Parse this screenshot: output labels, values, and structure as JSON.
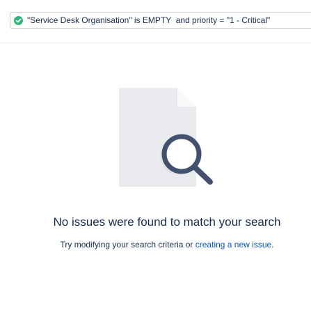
{
  "search": {
    "status_icon": "check-circle-icon",
    "query": "\"Service Desk Organisation\" is EMPTY  and priority = \"1 - Critical\""
  },
  "empty_state": {
    "illustration_icon": "document-search-icon",
    "title": "No issues were found to match your search",
    "subtitle_prefix": "Try modifying your search criteria or ",
    "create_link": "creating a new issue",
    "subtitle_suffix": "."
  },
  "colors": {
    "valid_green": "#36b37e",
    "link_blue": "#0052cc",
    "text_dark": "#172b4d"
  }
}
